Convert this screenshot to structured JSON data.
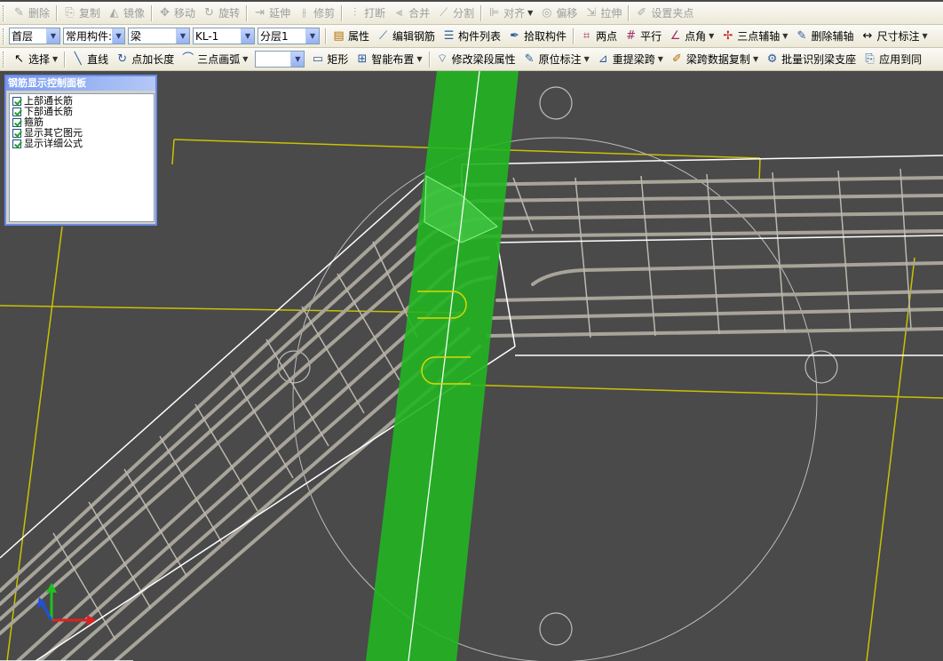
{
  "toolbar1": {
    "delete": "删除",
    "copy": "复制",
    "mirror": "镜像",
    "move": "移动",
    "rotate": "旋转",
    "extend": "延伸",
    "trim": "修剪",
    "break": "打断",
    "merge": "合并",
    "split": "分割",
    "align": "对齐",
    "offset": "偏移",
    "stretch": "拉伸",
    "set_grip": "设置夹点"
  },
  "toolbar2": {
    "floor": "首层",
    "component_type": "常用构件:",
    "category": "梁",
    "name": "KL-1",
    "layer": "分层1",
    "properties": "属性",
    "edit_rebar": "编辑钢筋",
    "component_list": "构件列表",
    "pick_component": "拾取构件",
    "two_point": "两点",
    "parallel": "平行",
    "point_angle": "点角",
    "three_point_axis": "三点辅轴",
    "delete_axis": "删除辅轴",
    "dimension": "尺寸标注"
  },
  "toolbar3": {
    "select": "选择",
    "line": "直线",
    "point_length": "点加长度",
    "three_point_arc": "三点画弧",
    "combo_value": "",
    "rectangle": "矩形",
    "smart_place": "智能布置",
    "modify_span_props": "修改梁段属性",
    "in_place_label": "原位标注",
    "re_extract_span": "重提梁跨",
    "copy_span_data": "梁跨数据复制",
    "batch_identify_support": "批量识别梁支座",
    "apply_same": "应用到同"
  },
  "panel": {
    "title": "钢筋显示控制面板",
    "items": [
      "上部通长筋",
      "下部通长筋",
      "箍筋",
      "显示其它图元",
      "显示详细公式"
    ]
  },
  "colors": {
    "canvas_bg": "#4a4a4a",
    "column_green": "#22b522",
    "grid_yellow": "#c9c200",
    "rebar_gray": "#a8a49a",
    "outline_white": "#ffffff"
  }
}
